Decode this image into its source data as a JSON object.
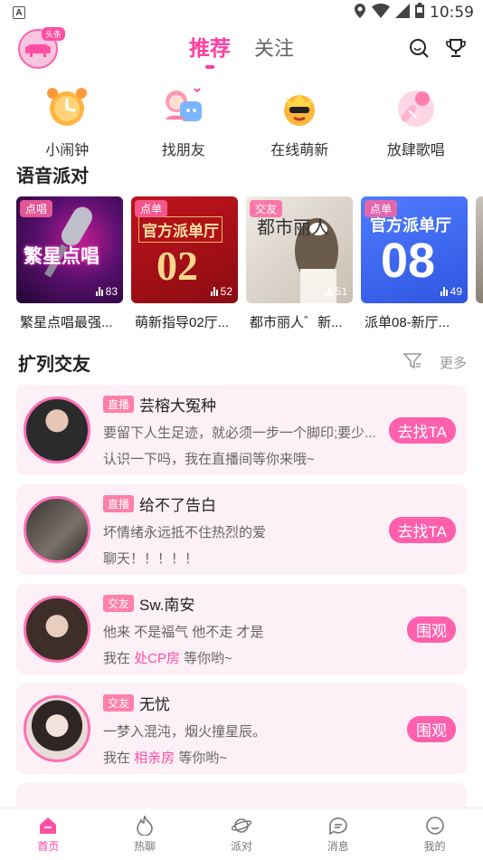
{
  "status": {
    "time": "10:59",
    "left_icon": "A"
  },
  "header": {
    "logo_badge": "头条",
    "tabs": [
      {
        "label": "推荐",
        "active": true
      },
      {
        "label": "关注",
        "active": false
      }
    ]
  },
  "quick": [
    {
      "label": "小闹钟",
      "icon": "alarm-clock-icon"
    },
    {
      "label": "找朋友",
      "icon": "friends-icon"
    },
    {
      "label": "在线萌新",
      "icon": "crown-face-icon"
    },
    {
      "label": "放肆歌唱",
      "icon": "microphone-icon"
    }
  ],
  "party": {
    "title": "语音派对",
    "cards": [
      {
        "tag": "点唱",
        "count": "83",
        "name": "繁星点唱最强...",
        "cover_text": "繁星点唱",
        "color1": "#3b0a4f",
        "color2": "#c01e8f"
      },
      {
        "tag": "点单",
        "count": "52",
        "name": "萌新指导02厅...",
        "cover_text": "官方派单厅",
        "cover_num": "02",
        "color1": "#a8101a",
        "color2": "#d8242c"
      },
      {
        "tag": "交友",
        "count": "51",
        "name": "都市丽人゛新...",
        "cover_text": "都市丽人",
        "color1": "#e9e4de",
        "color2": "#c8bfb4"
      },
      {
        "tag": "点单",
        "count": "49",
        "name": "派单08-新厅...",
        "cover_text": "官方派单厅",
        "cover_num": "08",
        "color1": "#3e6cf5",
        "color2": "#6e9bff"
      }
    ]
  },
  "friends": {
    "title": "扩列交友",
    "more": "更多",
    "items": [
      {
        "tag": "直播",
        "name": "芸榕大冤种",
        "line2": "要留下人生足迹，就必须一步一个脚印;要少...",
        "line3": "认识一下吗，我在直播间等你来哦~",
        "button": "去找TA",
        "avatar_color": "#3a3a3a"
      },
      {
        "tag": "直播",
        "name": "给不了告白",
        "line2": "坏情绪永远抵不住热烈的爱",
        "line3": "聊天！！！！！",
        "button": "去找TA",
        "avatar_color": "#5a5550"
      },
      {
        "tag": "交友",
        "name": "Sw.南安",
        "line2": "他来 不是福气  他不走 才是",
        "line3_pre": "我在 ",
        "line3_hl": "处CP房",
        "line3_post": " 等你哟~",
        "button": "围观",
        "avatar_color": "#4a3a34"
      },
      {
        "tag": "交友",
        "name": "  无忧",
        "line2": "一梦入混沌，烟火撞星辰。",
        "line3_pre": "我在 ",
        "line3_hl": "相亲房",
        "line3_post": " 等你哟~",
        "button": "围观",
        "avatar_color": "#d8c9c6"
      }
    ]
  },
  "nav": [
    {
      "label": "首页",
      "active": true
    },
    {
      "label": "热聊",
      "active": false
    },
    {
      "label": "派对",
      "active": false
    },
    {
      "label": "消息",
      "active": false
    },
    {
      "label": "我的",
      "active": false
    }
  ],
  "colors": {
    "accent": "#ff3fa0",
    "card_bg": "#fdf0f6"
  }
}
